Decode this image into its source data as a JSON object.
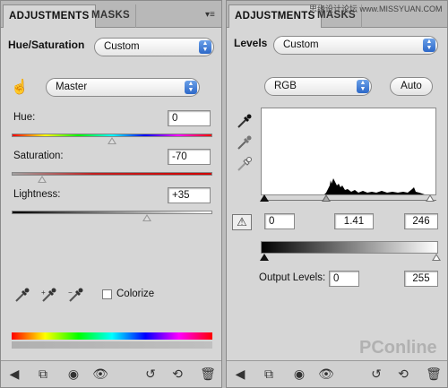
{
  "watermark_top": "思缘设计论坛 www.MISSYUAN.COM",
  "watermark_bottom": "PConline",
  "left_panel": {
    "tabs": [
      {
        "label": "ADJUSTMENTS"
      },
      {
        "label": "MASKS"
      }
    ],
    "title": "Hue/Saturation",
    "preset": "Custom",
    "channel": "Master",
    "hue": {
      "label": "Hue:",
      "value": "0",
      "level": 0
    },
    "saturation": {
      "label": "Saturation:",
      "value": "-70",
      "level": -70
    },
    "lightness": {
      "label": "Lightness:",
      "value": "+35",
      "level": 35
    },
    "colorize_label": "Colorize",
    "colorize_checked": false
  },
  "right_panel": {
    "tabs": [
      {
        "label": "ADJUSTMENTS"
      },
      {
        "label": "MASKS"
      }
    ],
    "title": "Levels",
    "preset": "Custom",
    "channel": "RGB",
    "auto_label": "Auto",
    "input_black": "0",
    "input_gamma": "1.41",
    "input_white": "246",
    "output_label": "Output Levels:",
    "output_black": "0",
    "output_white": "255"
  },
  "colors": {
    "select_arrow": "#2d68c8",
    "panel_bg": "#d6d6d6"
  },
  "icons": {
    "back": "arrow-left-icon",
    "expand": "expand-view-icon",
    "clip": "clip-layer-icon",
    "visibility": "eye-icon",
    "previous_state": "previous-state-icon",
    "reset": "reset-icon",
    "trash": "trash-icon"
  }
}
